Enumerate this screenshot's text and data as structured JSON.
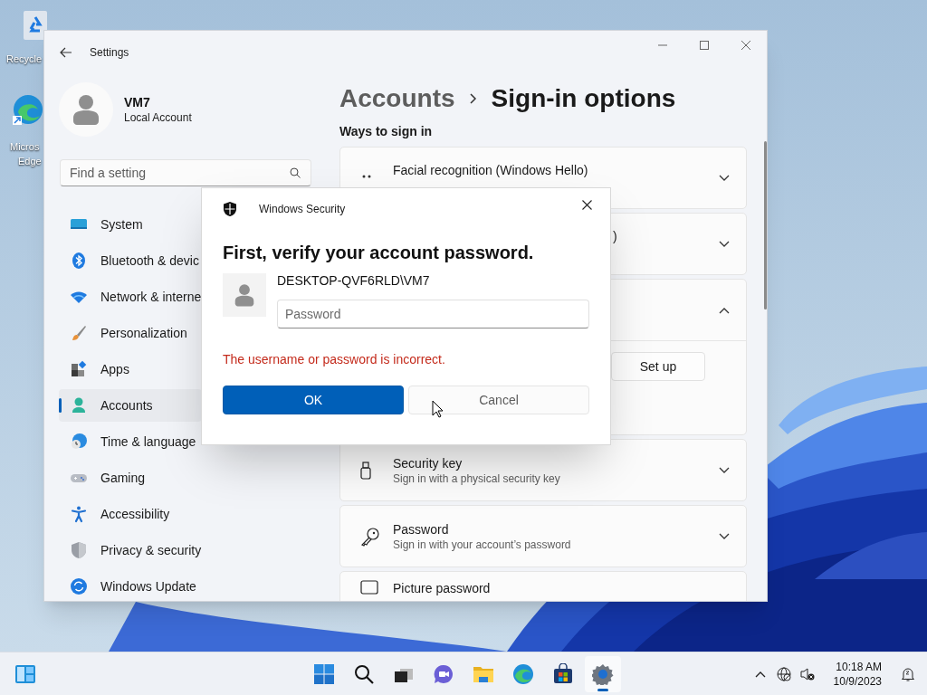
{
  "desktop_icons": [
    {
      "kind": "recycle-bin",
      "lines": [
        "Recycle"
      ]
    },
    {
      "kind": "edge",
      "lines": [
        "Micros",
        "Edge"
      ]
    }
  ],
  "settings_window": {
    "title": "Settings",
    "user": {
      "name": "VM7",
      "account_type": "Local Account"
    },
    "search": {
      "placeholder": "Find a setting"
    },
    "nav": [
      {
        "kind": "system",
        "label": "System",
        "selected": false
      },
      {
        "kind": "bluetooth",
        "label": "Bluetooth & devic",
        "selected": false
      },
      {
        "kind": "network",
        "label": "Network & interne",
        "selected": false
      },
      {
        "kind": "personalization",
        "label": "Personalization",
        "selected": false
      },
      {
        "kind": "apps",
        "label": "Apps",
        "selected": false
      },
      {
        "kind": "accounts",
        "label": "Accounts",
        "selected": true
      },
      {
        "kind": "time",
        "label": "Time & language",
        "selected": false
      },
      {
        "kind": "gaming",
        "label": "Gaming",
        "selected": false
      },
      {
        "kind": "accessibility",
        "label": "Accessibility",
        "selected": false
      },
      {
        "kind": "privacy",
        "label": "Privacy & security",
        "selected": false
      },
      {
        "kind": "update",
        "label": "Windows Update",
        "selected": false
      }
    ],
    "breadcrumb": {
      "parent": "Accounts",
      "current": "Sign-in options"
    },
    "section_title": "Ways to sign in",
    "cards": [
      {
        "kind": "face",
        "title": "Facial recognition (Windows Hello)",
        "expanded": false
      },
      {
        "kind": "covered",
        "title": ")",
        "expanded": false
      },
      {
        "kind": "covered",
        "expanded": true,
        "action": "Set up"
      },
      {
        "kind": "usb-key",
        "title": "Security key",
        "subtitle": "Sign in with a physical security key",
        "expanded": false
      },
      {
        "kind": "key",
        "title": "Password",
        "subtitle": "Sign in with your account’s password",
        "expanded": false
      },
      {
        "kind": "picture",
        "title": "Picture password"
      }
    ]
  },
  "dialog": {
    "title": "Windows Security",
    "heading": "First, verify your account password.",
    "account": "DESKTOP-QVF6RLD\\VM7",
    "password": {
      "placeholder": "Password"
    },
    "error": "The username or password is incorrect.",
    "buttons": [
      {
        "kind": "primary",
        "label": "OK"
      },
      {
        "kind": "secondary",
        "label": "Cancel"
      }
    ]
  },
  "taskbar": {
    "apps": [
      {
        "kind": "start",
        "active": false
      },
      {
        "kind": "search",
        "active": false
      },
      {
        "kind": "task-view",
        "active": false
      },
      {
        "kind": "chat",
        "active": false
      },
      {
        "kind": "file-explorer",
        "active": false
      },
      {
        "kind": "edge",
        "active": false
      },
      {
        "kind": "store",
        "active": false
      },
      {
        "kind": "settings",
        "active": true
      }
    ],
    "time": "10:18 AM",
    "date": "10/9/2023"
  }
}
